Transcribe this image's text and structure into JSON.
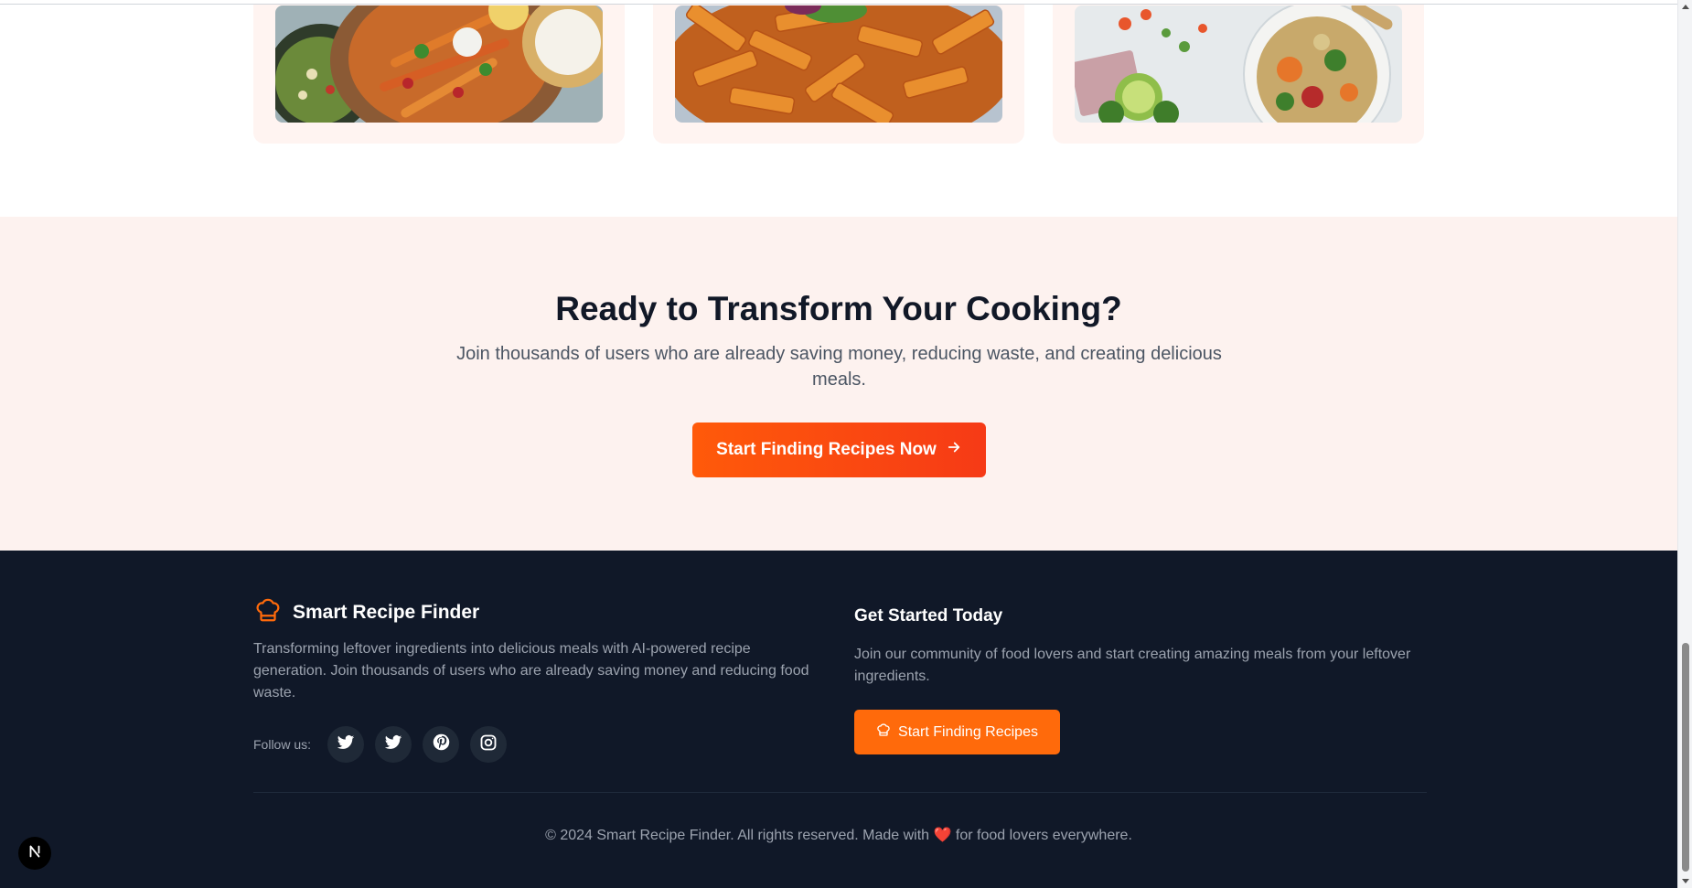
{
  "cards": [
    {
      "image": "fajitas-food-photo"
    },
    {
      "image": "penne-pasta-photo"
    },
    {
      "image": "vegetable-bowl-photo"
    }
  ],
  "cta": {
    "title": "Ready to Transform Your Cooking?",
    "subtitle": "Join thousands of users who are already saving money, reducing waste, and creating delicious meals.",
    "button_label": "Start Finding Recipes Now",
    "button_icon": "arrow-right-icon"
  },
  "footer": {
    "brand_name": "Smart Recipe Finder",
    "brand_icon": "chef-hat-icon",
    "description": "Transforming leftover ingredients into delicious meals with AI-powered recipe generation. Join thousands of users who are already saving money and reducing food waste.",
    "follow_label": "Follow us:",
    "social": [
      "twitter-icon",
      "twitter-icon",
      "pinterest-icon",
      "instagram-icon"
    ],
    "get_started_title": "Get Started Today",
    "get_started_desc": "Join our community of food lovers and start creating amazing meals from your leftover ingredients.",
    "get_started_button": "Start Finding Recipes",
    "copyright_left": "© 2024 Smart Recipe Finder. All rights reserved. Made with",
    "copyright_heart": "❤️",
    "copyright_right": "for food lovers everywhere."
  },
  "colors": {
    "accent": "#ff6a0b",
    "footer_bg": "#101828",
    "cta_bg": "#fdf2ef"
  }
}
